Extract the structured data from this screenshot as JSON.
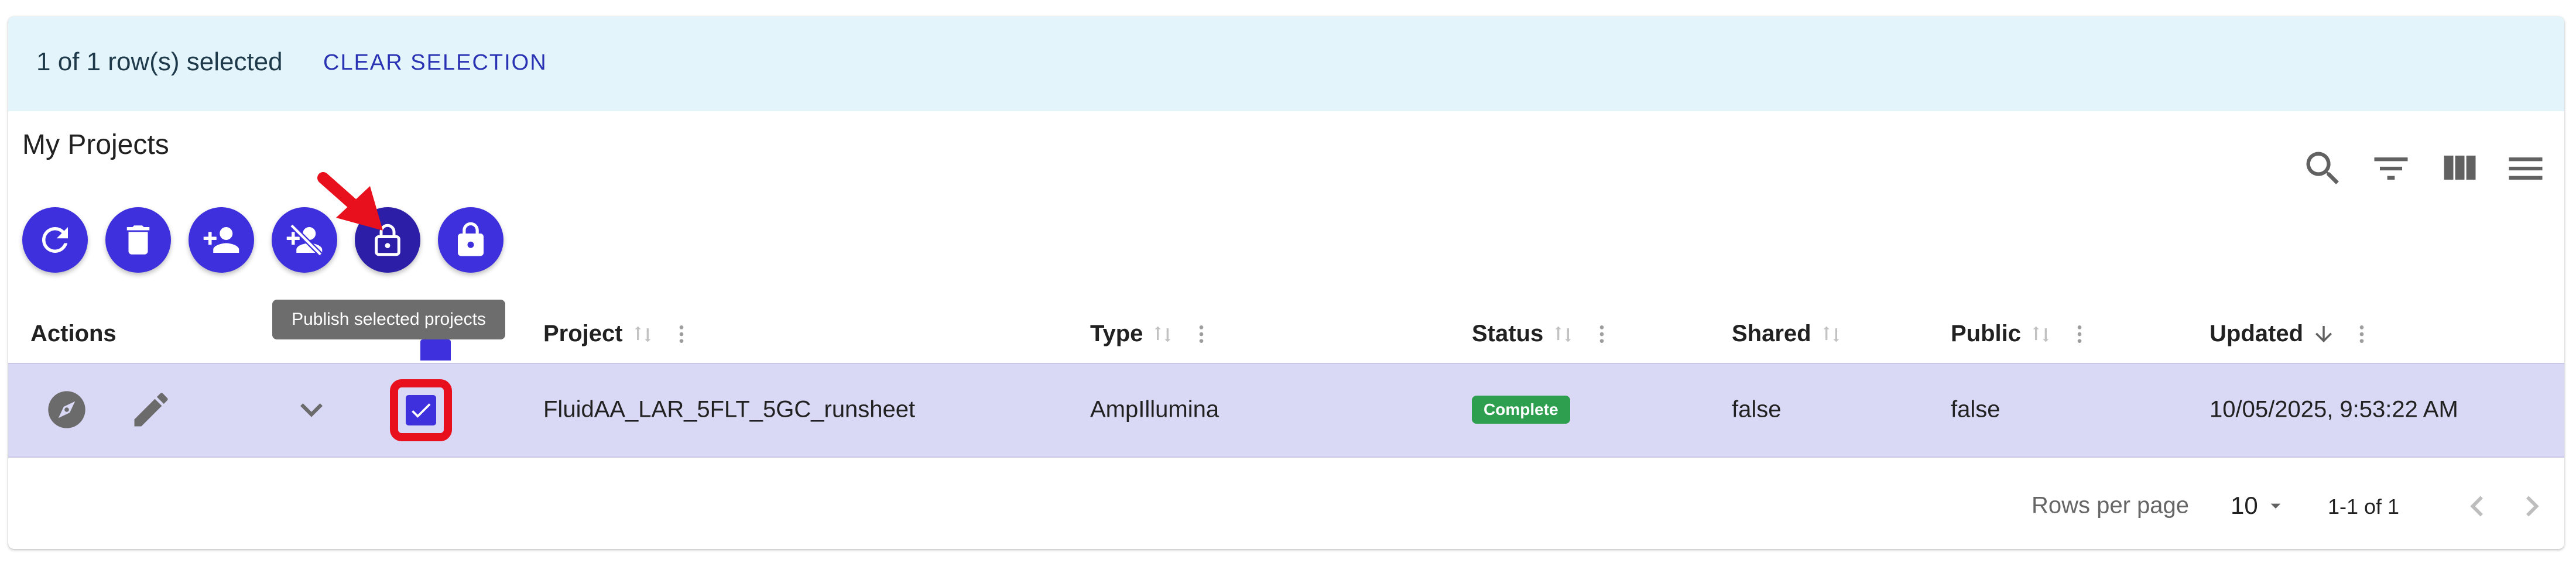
{
  "selection": {
    "text": "1 of 1 row(s) selected",
    "clear_label": "CLEAR SELECTION"
  },
  "table_title": "My Projects",
  "toolbar_icons": [
    "search-icon",
    "filter-icon",
    "view-columns-icon",
    "menu-icon"
  ],
  "actions": [
    "refresh-icon",
    "delete-icon",
    "add-user-icon",
    "remove-user-icon",
    "unlock-icon",
    "lock-icon"
  ],
  "tooltip": "Publish selected projects",
  "columns": {
    "actions": "Actions",
    "project": "Project",
    "type": "Type",
    "status": "Status",
    "shared": "Shared",
    "public": "Public",
    "updated": "Updated"
  },
  "rows": [
    {
      "project": "FluidAA_LAR_5FLT_5GC_runsheet",
      "type": "AmpIllumina",
      "status": "Complete",
      "shared": "false",
      "public": "false",
      "updated": "10/05/2025, 9:53:22 AM",
      "selected": true
    }
  ],
  "footer": {
    "rows_per_page_label": "Rows per page",
    "rows_per_page_value": "10",
    "range": "1-1 of 1"
  },
  "colors": {
    "accent": "#3e30dc",
    "selection_bar": "#e3f4fb",
    "selected_row": "#d9d8f5",
    "status_complete": "#2e9e4f",
    "highlight": "#e8101c"
  }
}
